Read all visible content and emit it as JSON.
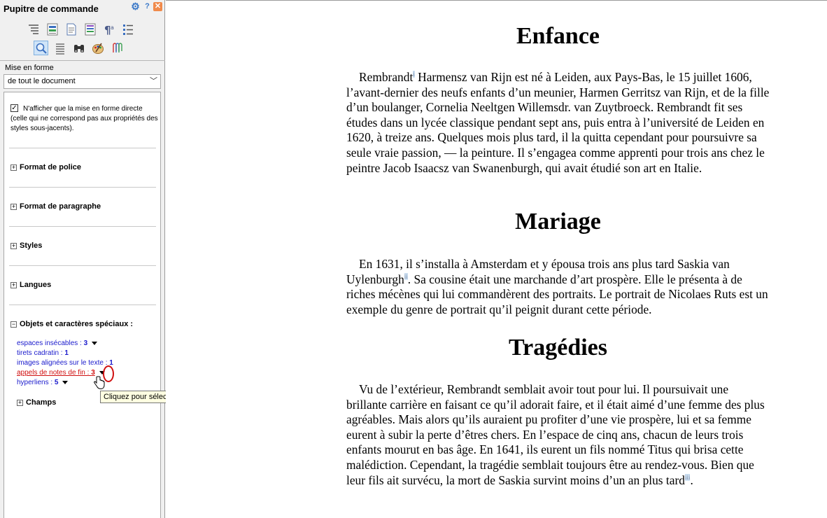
{
  "panel": {
    "title": "Pupitre de commande",
    "header_icons": [
      "gear-icon",
      "help-icon",
      "close-icon"
    ],
    "toolbar_row1": [
      "outline-icon",
      "paragraph-list-icon",
      "page-icon",
      "styles-icon",
      "pilcrow-icon",
      "bullets-icon"
    ],
    "toolbar_row2": [
      "inspector-icon",
      "lines-icon",
      "binoculars-icon",
      "palette-icon",
      "paperclips-icon"
    ],
    "active_tool": "inspector-icon",
    "format_label": "Mise en forme",
    "scope_value": "de tout le document",
    "direct_only_checked": true,
    "direct_only_text": "N'afficher que la mise en forme directe (celle qui ne correspond pas aux propriétés des styles sous-jacents).",
    "sections": {
      "font": "Format de police",
      "paragraph": "Format de paragraphe",
      "styles": "Styles",
      "languages": "Langues",
      "objects": "Objets et caractères spéciaux :",
      "fields": "Champs"
    },
    "objects": [
      {
        "label": "espaces insécables : ",
        "count": "3",
        "menu": true
      },
      {
        "label": "tirets cadratin : ",
        "count": "1",
        "menu": false
      },
      {
        "label": "images alignées sur le texte : ",
        "count": "1",
        "menu": false
      },
      {
        "label": "appels de notes de fin : ",
        "count": "3",
        "menu": true
      },
      {
        "label": "hyperliens : ",
        "count": "5",
        "menu": true
      }
    ],
    "tooltip": "Cliquez pour sélectionner les objets dans le document",
    "accent_color": "#1a1acc",
    "hover_color": "#d01010"
  },
  "document": {
    "sections": [
      {
        "heading": "Enfance",
        "paragraph_before": "Rembrandt",
        "note": "i",
        "paragraph_after": " Harmensz van Rijn est né à Leiden, aux Pays-Bas, le 15 juillet 1606, l’avant-dernier des neufs enfants d’un meunier, Harmen Gerritsz van Rijn, et de la fille d’un boulanger, Cornelia Neeltgen Willemsdr. van Zuytbroeck. Rembrandt fit ses études dans un lycée classique pendant sept ans, puis entra à l’université de Leiden en 1620, à treize ans. Quelques mois plus tard, il la quitta cependant pour poursuivre sa seule vraie passion, — la peinture. Il s’engagea comme apprenti pour trois ans chez le peintre Jacob Isaacsz van Swanenburgh, qui avait étudié son art en Italie."
      },
      {
        "heading": "Mariage",
        "paragraph_before": "En 1631, il s’installa à Amsterdam et y épousa trois ans plus tard Saskia van Uylenburgh",
        "note": "ii",
        "paragraph_after": ". Sa cousine était une marchande d’art prospère. Elle le présenta à de riches mécènes qui lui commandèrent des portraits. Le portrait de Nicolaes Ruts est un exemple du genre de portrait qu’il peignit durant cette période."
      },
      {
        "heading": "Tragédies",
        "paragraph_before": "Vu de l’extérieur, Rembrandt semblait avoir tout pour lui. Il poursuivait une brillante carrière en faisant ce qu’il adorait faire, et il était aimé d’une femme des plus agréables. Mais alors qu’ils auraient pu profiter d’une vie prospère, lui et sa femme eurent à subir la perte d’êtres chers. En l’espace de cinq ans, chacun de leurs trois enfants mourut en bas âge. En 1641, ils eurent un fils nommé Titus qui brisa cette malédiction. Cependant, la tragédie semblait toujours être au rendez-vous. Bien que leur fils ait survécu, la mort de Saskia survint moins d’un an plus tard",
        "note": "iii",
        "paragraph_after": "."
      }
    ]
  }
}
